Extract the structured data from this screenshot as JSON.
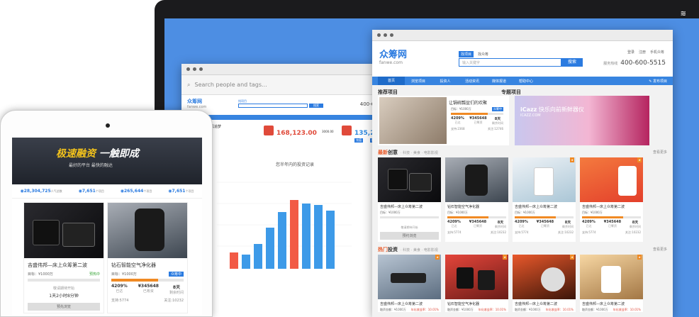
{
  "laptop": {
    "brand_icon": "brand-mark-icon"
  },
  "win2": {
    "search_placeholder": "Search people and tags...",
    "logo": "众筹网",
    "logo_sub": "fanwe.com",
    "search_tabs": [
      "找项目",
      "找众筹"
    ],
    "phone": "400-600-5",
    "search_button": "搜索",
    "user_label": "追风追梦",
    "stats": [
      "168,123.00",
      "135,236.00"
    ],
    "stat_sub": [
      "3000.00",
      "充值",
      "提现"
    ],
    "chart_title": "您半年内的投资记录"
  },
  "win1": {
    "logo": "众筹网",
    "logo_sub": "fanwe.com",
    "search_tabs": [
      "找项目",
      "找众筹"
    ],
    "search_placeholder": "输入关键字",
    "search_button": "搜索",
    "top_links": [
      "登录",
      "注册",
      "手机众筹"
    ],
    "phone_label": "服务热线",
    "phone": "400-600-5515",
    "nav": [
      "首页",
      "浏览项目",
      "投资人",
      "活动资讯",
      "媒体报道",
      "帮助中心"
    ],
    "publish": "发布项目",
    "sec_recommend": "推荐项目",
    "sec_special": "专题项目",
    "feat_title": "让锅碗瓢盆们的欢聚",
    "feat_status": "众筹中",
    "feat_nums": [
      "4209%",
      "¥345648",
      "8天"
    ],
    "feat_labels": [
      "已达",
      "已筹资",
      "剩余时间"
    ],
    "feat_support": "支持:2368",
    "feat_fav": "关注:12746",
    "special_brand": "iCazz",
    "special_title": "快乐向前新鲜器仪",
    "special_sub": "ICAZZ.COM",
    "sec_new_hl": "最新",
    "sec_new": "创意",
    "sec_new_tags": "· 科技 · 美食 · 电影影视",
    "sec_hot_hl": "热门",
    "sec_hot": "投资",
    "sec_hot_tags": "· 科技 · 美食 · 电影影视",
    "more": "查看更多",
    "cards": [
      {
        "title": "吉盛伟邦—床上众筹第二波",
        "goal": "目标：¥1000万",
        "status": "",
        "fill": 0,
        "wait": "敬请期待开始",
        "btn": "预约浏览",
        "nums": [],
        "labels": [],
        "support": "",
        "fav": ""
      },
      {
        "title": "钻石智能空气净化器",
        "goal": "目标：¥1000万",
        "status": "",
        "fill": 0.7,
        "nums": [
          "4209%",
          "¥345648",
          "8天"
        ],
        "labels": [
          "已达",
          "已筹资",
          "剩余时间"
        ],
        "support": "支持:5774",
        "fav": "关注:10232"
      },
      {
        "title": "吉盛伟邦—床上众筹第二波",
        "goal": "目标：¥1000万",
        "status": "",
        "fill": 0.7,
        "nums": [
          "4209%",
          "¥345648",
          "8天"
        ],
        "labels": [
          "已达",
          "已筹资",
          "剩余时间"
        ],
        "support": "支持:5774",
        "fav": "关注:10232"
      },
      {
        "title": "吉盛伟邦—床上众筹第二波",
        "goal": "目标：¥1000万",
        "status": "",
        "fill": 0.7,
        "nums": [
          "4209%",
          "¥345648",
          "8天"
        ],
        "labels": [
          "已达",
          "已筹资",
          "剩余时间"
        ],
        "support": "支持:5774",
        "fav": "关注:10232"
      }
    ],
    "hot_cards": [
      {
        "title": "吉盛伟邦—床上众筹第二波",
        "goal": "融资金额：¥1000万",
        "rate": "年化收益率：10.01%"
      },
      {
        "title": "钻石智能空气净化器",
        "goal": "融资金额：¥1000万",
        "rate": "年化收益率：10.01%"
      },
      {
        "title": "吉盛伟邦—床上众筹第二波",
        "goal": "融资金额：¥1000万",
        "rate": "年化收益率：10.01%"
      },
      {
        "title": "吉盛伟邦—床上众筹第二波",
        "goal": "融资金额：¥1000万",
        "rate": "年化收益率：10.01%"
      }
    ]
  },
  "tablet": {
    "hero_hl": "极速融资",
    "hero_rest": " 一触即成",
    "hero_sub": "最好的平台  最快的融达",
    "stats": [
      {
        "value": "28,304,725",
        "unit": "人气总数"
      },
      {
        "value": "7,651",
        "unit": "个项目"
      },
      {
        "value": "265,644",
        "unit": "个项目"
      },
      {
        "value": "7,651",
        "unit": "个项目"
      }
    ],
    "cards": [
      {
        "title": "吉盛伟邦—床上众筹第二波",
        "goal": "目标：¥1000万",
        "status": "预热中",
        "wait": "敬请期待开始",
        "time": "1天2小时8分钟",
        "btn": "预先浏览"
      },
      {
        "title": "钻石智能空气净化器",
        "goal": "目标：¥1000万",
        "status": "众筹中",
        "fill": 0.65,
        "nums": [
          "4209%",
          "¥345648",
          "8天"
        ],
        "labels": [
          "已达",
          "已筹资",
          "剩余时间"
        ],
        "support": "支持:5774",
        "fav": "关注:10232"
      }
    ]
  }
}
